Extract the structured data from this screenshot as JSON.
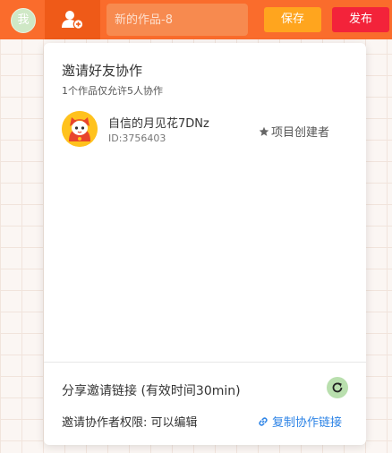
{
  "topbar": {
    "avatar_text": "我",
    "collab_icon": "add-user-icon",
    "title_placeholder": "新的作品-8",
    "save_label": "保存",
    "publish_label": "发布",
    "colors": {
      "bar": "#fa6c2c",
      "save": "#ffa51e",
      "publish": "#f3233a"
    }
  },
  "panel": {
    "title": "邀请好友协作",
    "subtitle": "1个作品仅允许5人协作",
    "members": [
      {
        "name": "自信的月见花7DNz",
        "id": "ID:3756403",
        "role_icon": "star-icon",
        "role": "项目创建者"
      }
    ],
    "share_title": "分享邀请链接 (有效时间30min)",
    "refresh_icon": "refresh-icon",
    "permission": "邀请协作者权限: 可以编辑",
    "copy_link_icon": "link-icon",
    "copy_link_label": "复制协作链接"
  }
}
